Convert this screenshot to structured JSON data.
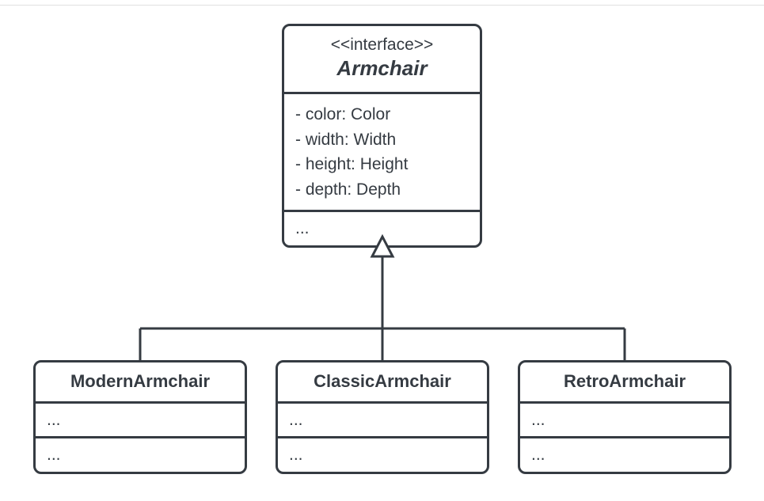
{
  "colors": {
    "stroke": "#353b42",
    "bg": "#ffffff"
  },
  "interface": {
    "stereotype": "<<interface>>",
    "name": "Armchair",
    "attributes": [
      "- color: Color",
      "- width: Width",
      "- height: Height",
      "- depth: Depth"
    ],
    "methods_placeholder": "..."
  },
  "subclasses": [
    {
      "name": "ModernArmchair",
      "attrs_placeholder": "...",
      "methods_placeholder": "..."
    },
    {
      "name": "ClassicArmchair",
      "attrs_placeholder": "...",
      "methods_placeholder": "..."
    },
    {
      "name": "RetroArmchair",
      "attrs_placeholder": "...",
      "methods_placeholder": "..."
    }
  ]
}
